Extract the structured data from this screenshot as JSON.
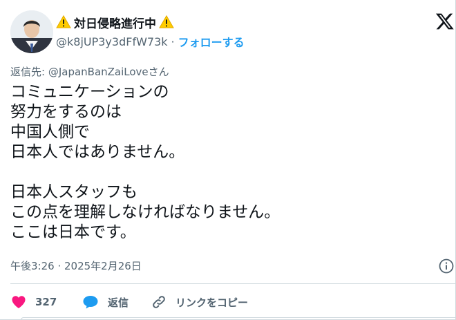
{
  "author": {
    "display_name": "対日侵略進行中",
    "handle": "@k8jUP3y3dFfW73k",
    "separator": "·",
    "follow_label": "フォローする"
  },
  "post": {
    "reply_to": "返信先: @JapanBanZaiLoveさん",
    "lines": [
      "コミュニケーションの",
      "努力をするのは",
      "中国人側で",
      "日本人ではありません。",
      "",
      "日本人スタッフも",
      "この点を理解しなければなりません。",
      "ここは日本です。"
    ],
    "timestamp": "午後3:26 · 2025年2月26日"
  },
  "actions": {
    "like_count": "327",
    "reply_label": "返信",
    "copy_link_label": "リンクをコピー"
  },
  "colors": {
    "accent": "#1d9bf0",
    "like": "#f91880",
    "muted": "#536471",
    "text": "#0f1419",
    "border": "#cfd9de",
    "warning": "#ffcc00"
  },
  "icons": {
    "logo": "x-logo-icon",
    "warning": "warning-icon",
    "info": "info-icon",
    "like": "heart-icon",
    "reply": "speech-bubble-icon",
    "link": "link-icon"
  }
}
